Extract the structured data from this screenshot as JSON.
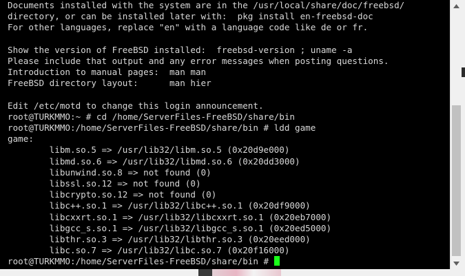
{
  "terminal": {
    "lines": [
      "Documents installed with the system are in the /usr/local/share/doc/freebsd/",
      "directory, or can be installed later with:  pkg install en-freebsd-doc",
      "For other languages, replace \"en\" with a language code like de or fr.",
      "",
      "Show the version of FreeBSD installed:  freebsd-version ; uname -a",
      "Please include that output and any error messages when posting questions.",
      "Introduction to manual pages:  man man",
      "FreeBSD directory layout:      man hier",
      "",
      "Edit /etc/motd to change this login announcement.",
      "root@TURKMMO:~ # cd /home/ServerFiles-FreeBSD/share/bin",
      "root@TURKMMO:/home/ServerFiles-FreeBSD/share/bin # ldd game",
      "game:",
      "        libm.so.5 => /usr/lib32/libm.so.5 (0x20d9e000)",
      "        libmd.so.6 => /usr/lib32/libmd.so.6 (0x20dd3000)",
      "        libunwind.so.8 => not found (0)",
      "        libssl.so.12 => not found (0)",
      "        libcrypto.so.12 => not found (0)",
      "        libc++.so.1 => /usr/lib32/libc++.so.1 (0x20df9000)",
      "        libcxxrt.so.1 => /usr/lib32/libcxxrt.so.1 (0x20eb7000)",
      "        libgcc_s.so.1 => /usr/lib32/libgcc_s.so.1 (0x20ed5000)",
      "        libthr.so.3 => /usr/lib32/libthr.so.3 (0x20eed000)",
      "        libc.so.7 => /usr/lib32/libc.so.7 (0x20f16000)"
    ],
    "prompt": "root@TURKMMO:/home/ServerFiles-FreeBSD/share/bin # ",
    "colors": {
      "background": "#000000",
      "foreground": "#d8d8d8",
      "cursor": "#19ff19"
    }
  },
  "scrollbar": {
    "up_icon": "triangle-up-icon",
    "down_icon": "triangle-down-icon",
    "thumb_color": "#c1c1c1"
  }
}
